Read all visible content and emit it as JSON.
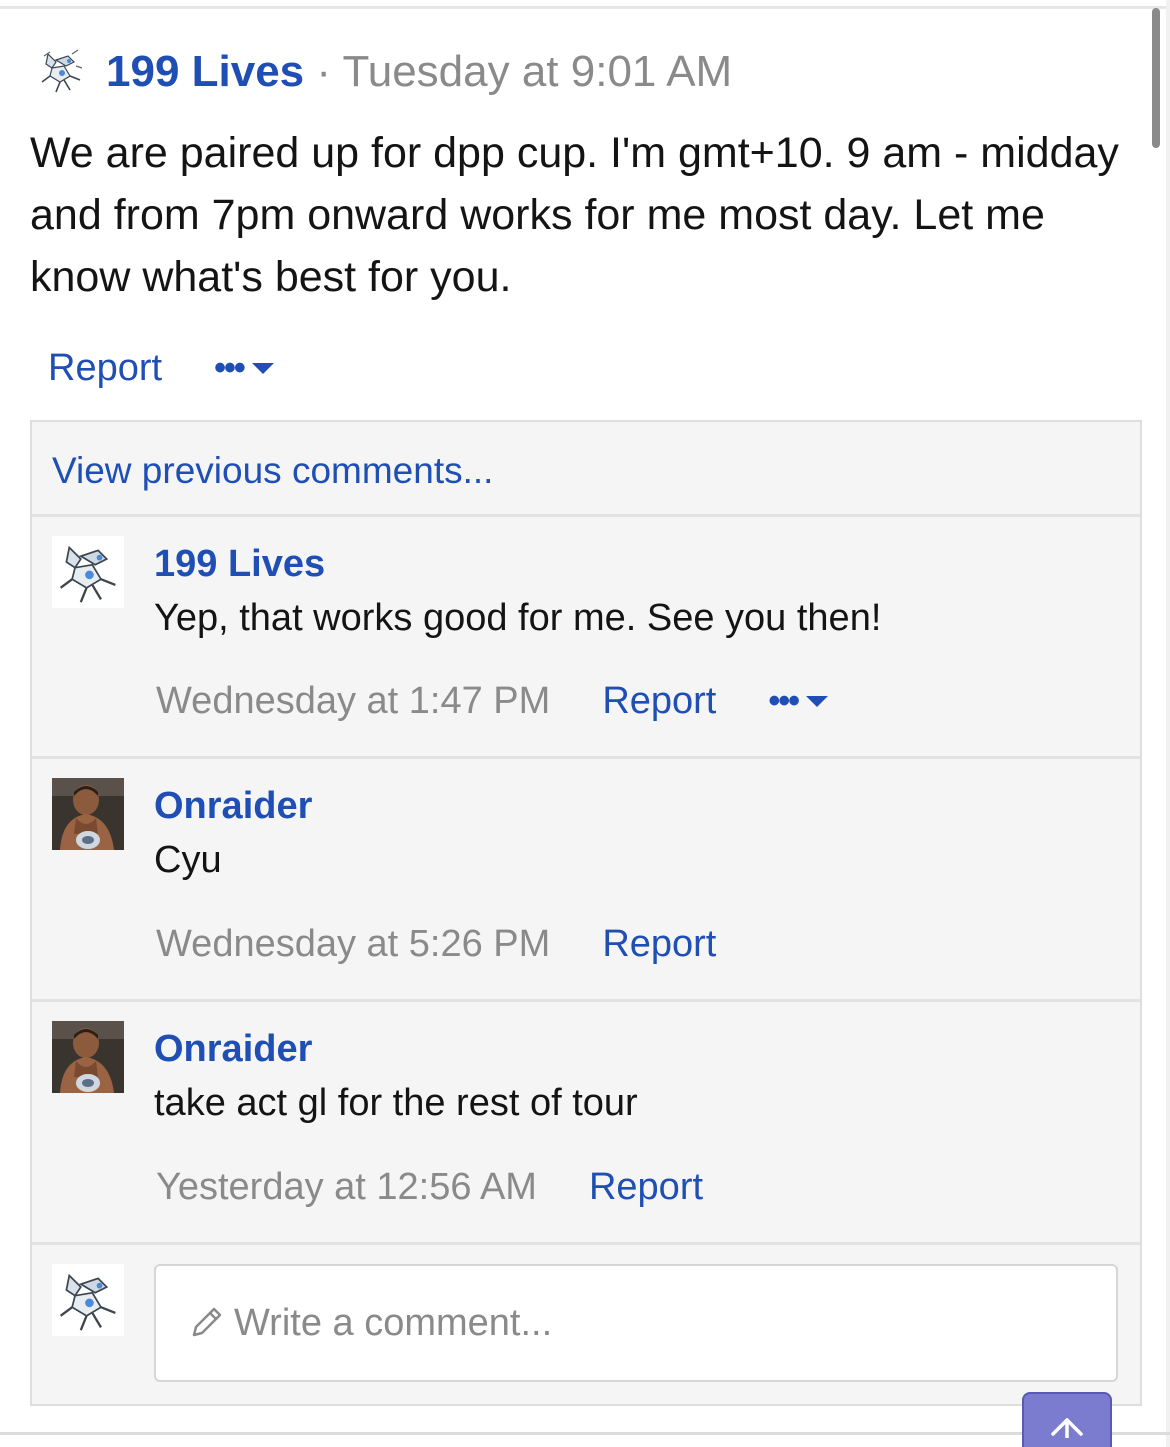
{
  "post": {
    "author": "199 Lives",
    "separator": "·",
    "timestamp": "Tuesday at 9:01 AM",
    "body": "We are paired up for dpp cup. I'm gmt+10. 9 am - midday and from 7pm onward works for me most day. Let me know what's best for you.",
    "report_label": "Report",
    "more_label": "•••",
    "author_avatar_icon": "dragon-sprite-icon"
  },
  "comments": {
    "view_previous_label": "View previous comments...",
    "items": [
      {
        "author": "199 Lives",
        "text": "Yep, that works good for me. See you then!",
        "timestamp": "Wednesday at 1:47 PM",
        "report_label": "Report",
        "more_label": "•••",
        "avatar_icon": "dragon-sprite-icon"
      },
      {
        "author": "Onraider",
        "text": "Cyu",
        "timestamp": "Wednesday at 5:26 PM",
        "report_label": "Report",
        "avatar_icon": "person-photo-icon"
      },
      {
        "author": "Onraider",
        "text": "take act gl for the rest of tour",
        "timestamp": "Yesterday at 12:56 AM",
        "report_label": "Report",
        "avatar_icon": "person-photo-icon"
      }
    ],
    "write_placeholder": "Write a comment..."
  },
  "colors": {
    "link": "#1f4fb4",
    "muted": "#8a8a8a",
    "comments_bg": "#f5f5f5",
    "scroll_top_button": "#7b7bcf"
  }
}
